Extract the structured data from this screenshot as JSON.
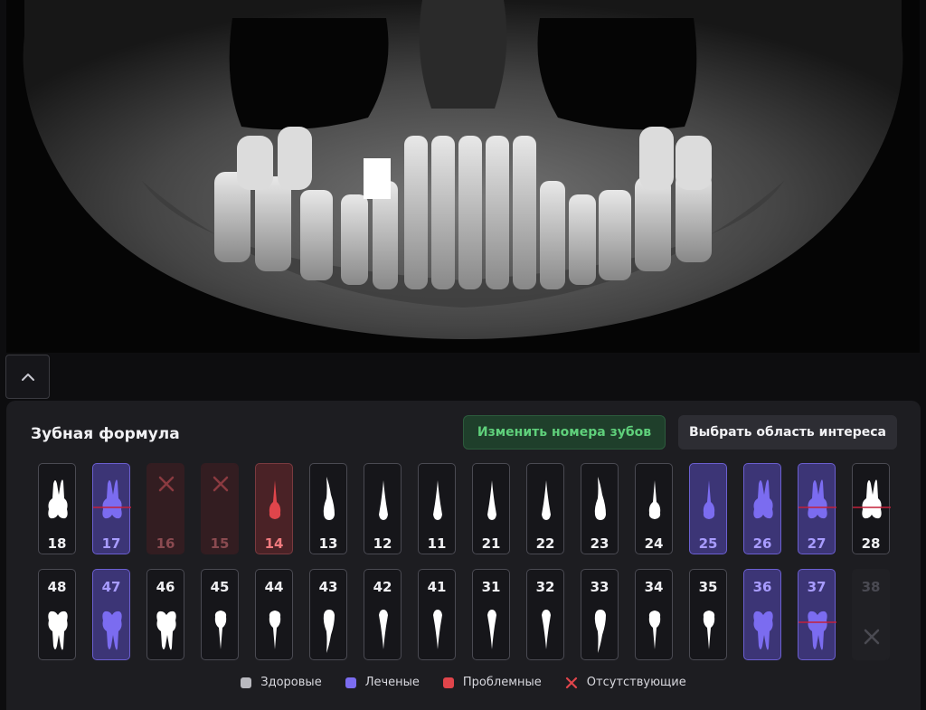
{
  "panel": {
    "title": "Зубная формула",
    "renumber_button": "Изменить номера зубов",
    "roi_button": "Выбрать область интереса"
  },
  "colors": {
    "healthy": "#b9b9bf",
    "treated": "#7b6cf0",
    "problem": "#e0454b",
    "missing": "#e0454b"
  },
  "upper_row": [
    {
      "n": "18",
      "status": "healthy",
      "shape": "molar"
    },
    {
      "n": "17",
      "status": "treated",
      "shape": "molar",
      "mark": true
    },
    {
      "n": "16",
      "status": "missing"
    },
    {
      "n": "15",
      "status": "missing"
    },
    {
      "n": "14",
      "status": "problem",
      "shape": "premolar"
    },
    {
      "n": "13",
      "status": "healthy",
      "shape": "canine"
    },
    {
      "n": "12",
      "status": "healthy",
      "shape": "incisor"
    },
    {
      "n": "11",
      "status": "healthy",
      "shape": "incisor"
    },
    {
      "n": "21",
      "status": "healthy",
      "shape": "incisor"
    },
    {
      "n": "22",
      "status": "healthy",
      "shape": "incisor"
    },
    {
      "n": "23",
      "status": "healthy",
      "shape": "canine"
    },
    {
      "n": "24",
      "status": "healthy",
      "shape": "premolar"
    },
    {
      "n": "25",
      "status": "treated",
      "shape": "premolar"
    },
    {
      "n": "26",
      "status": "treated",
      "shape": "molar"
    },
    {
      "n": "27",
      "status": "treated",
      "shape": "molar",
      "mark": true
    },
    {
      "n": "28",
      "status": "healthy",
      "shape": "molar",
      "mark": true
    }
  ],
  "lower_row": [
    {
      "n": "48",
      "status": "healthy",
      "shape": "molar"
    },
    {
      "n": "47",
      "status": "treated",
      "shape": "molar"
    },
    {
      "n": "46",
      "status": "healthy",
      "shape": "molar"
    },
    {
      "n": "45",
      "status": "healthy",
      "shape": "premolar"
    },
    {
      "n": "44",
      "status": "healthy",
      "shape": "premolar"
    },
    {
      "n": "43",
      "status": "healthy",
      "shape": "canine"
    },
    {
      "n": "42",
      "status": "healthy",
      "shape": "incisor"
    },
    {
      "n": "41",
      "status": "healthy",
      "shape": "incisor"
    },
    {
      "n": "31",
      "status": "healthy",
      "shape": "incisor"
    },
    {
      "n": "32",
      "status": "healthy",
      "shape": "incisor"
    },
    {
      "n": "33",
      "status": "healthy",
      "shape": "canine"
    },
    {
      "n": "34",
      "status": "healthy",
      "shape": "premolar"
    },
    {
      "n": "35",
      "status": "healthy",
      "shape": "premolar"
    },
    {
      "n": "36",
      "status": "treated",
      "shape": "molar"
    },
    {
      "n": "37",
      "status": "treated",
      "shape": "molar",
      "mark": true
    },
    {
      "n": "38",
      "status": "missing-faint"
    }
  ],
  "legend": [
    {
      "label": "Здоровые",
      "type": "swatch",
      "color": "#b9b9bf"
    },
    {
      "label": "Леченые",
      "type": "swatch",
      "color": "#7b6cf0"
    },
    {
      "label": "Проблемные",
      "type": "swatch",
      "color": "#e0454b"
    },
    {
      "label": "Отсутствующие",
      "type": "cross",
      "color": "#e0454b"
    }
  ]
}
